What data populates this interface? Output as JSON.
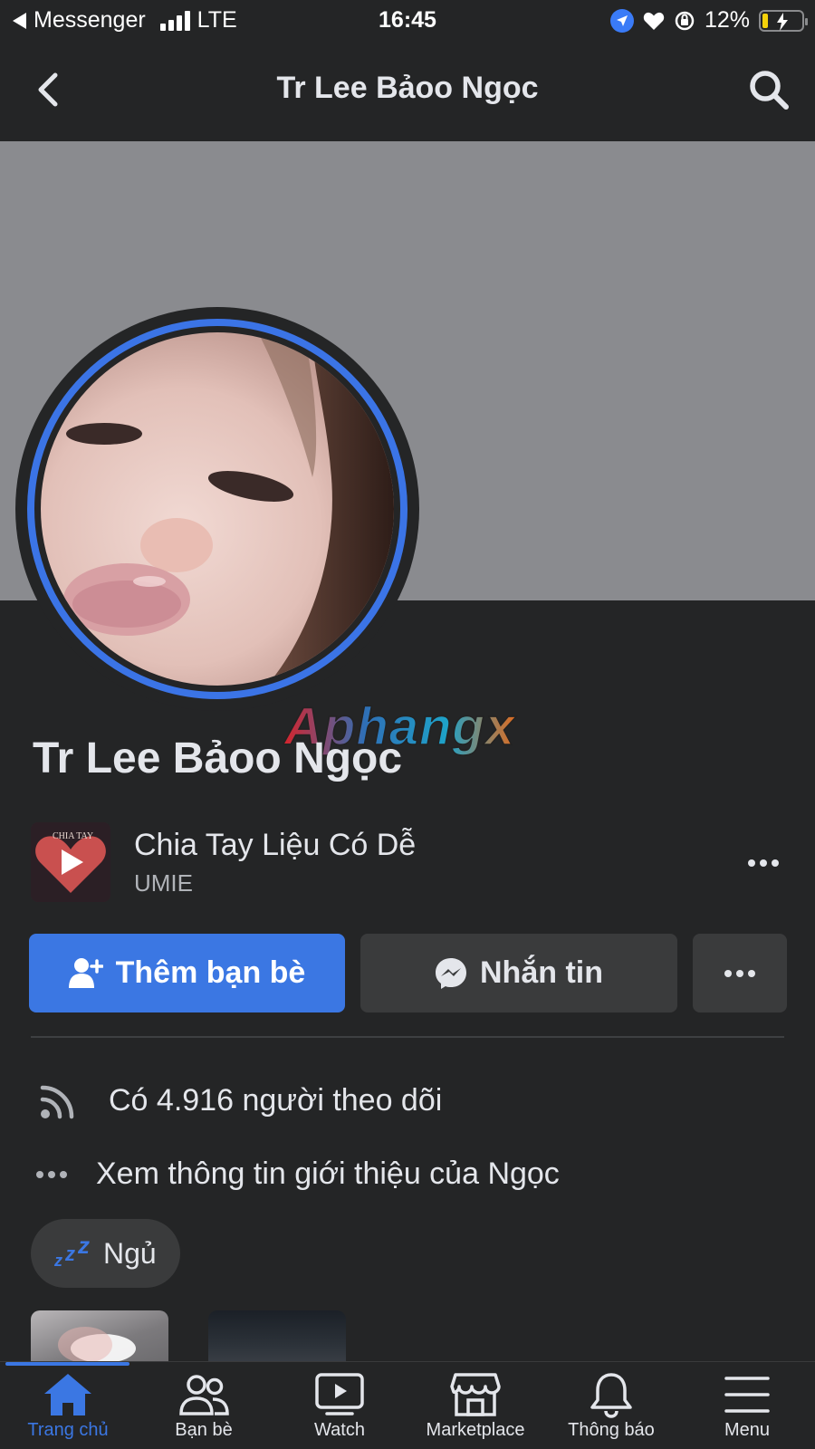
{
  "status_bar": {
    "back_app": "Messenger",
    "network": "LTE",
    "time": "16:45",
    "battery": "12%"
  },
  "header": {
    "title": "Tr Lee Bảoo Ngọc"
  },
  "watermark": "Aphangx",
  "profile": {
    "name": "Tr Lee Bảoo Ngọc",
    "song": {
      "title": "Chia Tay Liệu Có Dễ",
      "artist": "UMIE",
      "cover_text": "CHIA TAY"
    },
    "buttons": {
      "add_friend": "Thêm bạn bè",
      "message": "Nhắn tin"
    },
    "followers_text": "Có 4.916 người theo dõi",
    "about_text": "Xem thông tin giới thiệu của Ngọc",
    "status_label": "Ngủ"
  },
  "tabbar": {
    "items": [
      {
        "label": "Trang chủ",
        "icon": "home-icon",
        "active": true
      },
      {
        "label": "Bạn bè",
        "icon": "friends-icon"
      },
      {
        "label": "Watch",
        "icon": "watch-icon"
      },
      {
        "label": "Marketplace",
        "icon": "marketplace-icon"
      },
      {
        "label": "Thông báo",
        "icon": "bell-icon"
      },
      {
        "label": "Menu",
        "icon": "menu-icon"
      }
    ]
  },
  "colors": {
    "background": "#242526",
    "accent": "#3b77e3",
    "cover": "#8a8b8f"
  }
}
